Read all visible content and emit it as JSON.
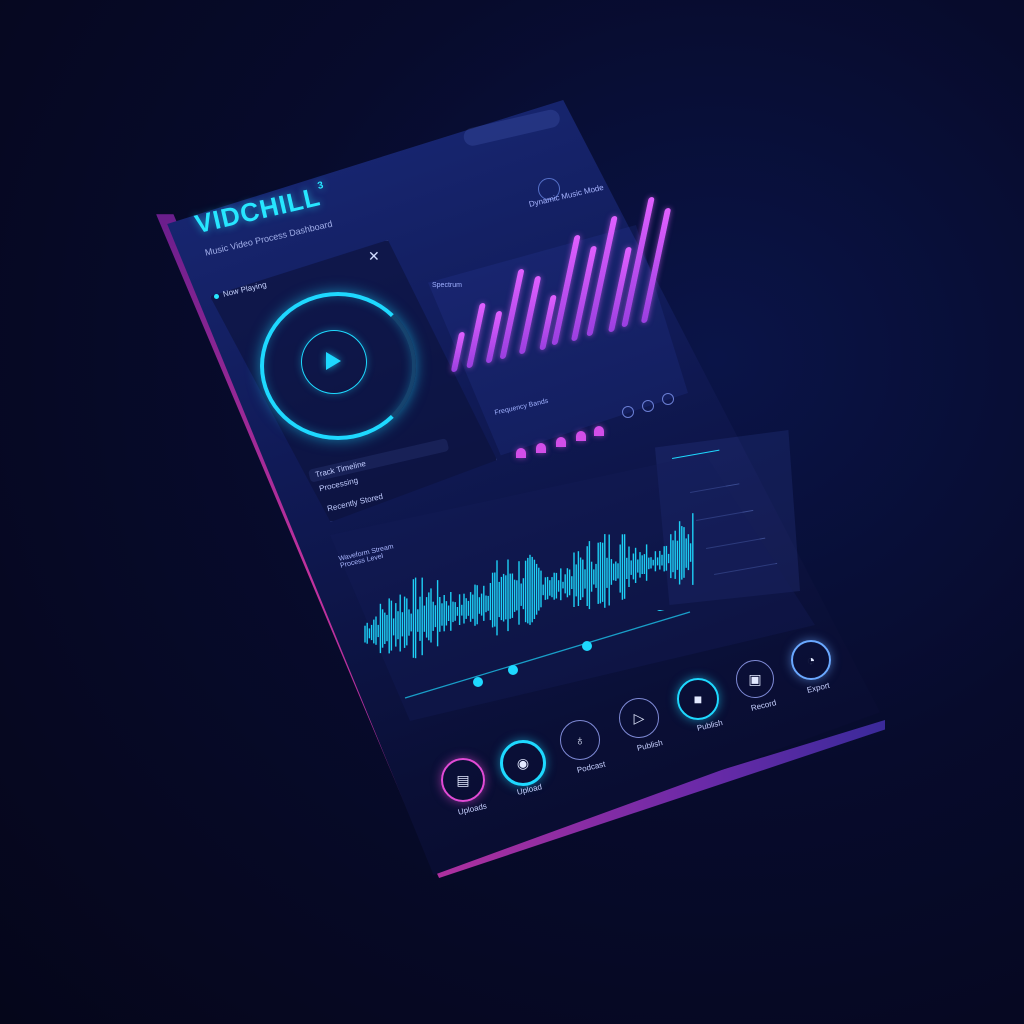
{
  "app": {
    "brand": "VIDCHILL",
    "brand_sup": "3",
    "subtitle": "Music Video Process Dashboard",
    "header_link": "Dynamic Music Mode"
  },
  "player": {
    "title": "Now Playing",
    "fields": [
      "Track Timeline",
      "Processing",
      "Recently Stored"
    ]
  },
  "spectrum": {
    "label": "Spectrum",
    "footer": "Frequency Bands"
  },
  "waveform": {
    "title_line1": "Waveform Stream",
    "title_line2": "Process Level"
  },
  "controls": [
    {
      "label": "Uploads",
      "icon": "document-icon",
      "color": "#e24bd6"
    },
    {
      "label": "Upload",
      "icon": "lock-icon",
      "color": "#1ed9ff"
    },
    {
      "label": "Podcast",
      "icon": "bell-icon",
      "color": "#7f8ad6"
    },
    {
      "label": "Publish",
      "icon": "play-icon",
      "color": "#7f8ad6"
    },
    {
      "label": "Publish",
      "icon": "stop-icon",
      "color": "#1ed9ff"
    },
    {
      "label": "Record",
      "icon": "screen-icon",
      "color": "#7f8ad6"
    },
    {
      "label": "Export",
      "icon": "timer-icon",
      "color": "#6aa8ff"
    }
  ],
  "colors": {
    "accent": "#1ed9ff",
    "magenta": "#e060ff",
    "edge": "#c2329e"
  }
}
